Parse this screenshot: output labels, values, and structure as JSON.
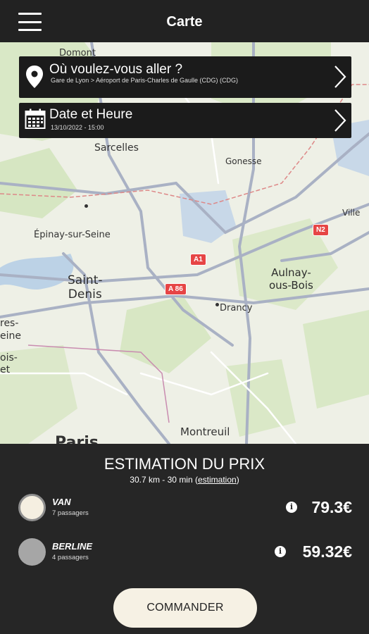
{
  "header": {
    "title": "Carte",
    "menu_icon": "hamburger-icon"
  },
  "map": {
    "places": {
      "domont": "Domont",
      "sarcelles": "Sarcelles",
      "gonesse": "Gonesse",
      "villepinte": "Ville",
      "epinay": "Épinay-sur-Seine",
      "saint_denis": "Saint-\nDenis",
      "aulnay": "Aulnay-\nous-Bois",
      "drancy": "Drancy",
      "cut_left_1": "res-\neine",
      "cut_left_2": "ois-\net",
      "montreuil": "Montreuil",
      "paris": "Paris"
    },
    "roads": {
      "a1": "A1",
      "a86": "A 86",
      "n2": "N2"
    }
  },
  "destination": {
    "label": "Où voulez-vous aller ?",
    "detail": "Gare de Lyon > Aéroport de Paris-Charles de Gaulle (CDG) (CDG)",
    "icon": "location-pin-icon"
  },
  "datetime": {
    "label": "Date et Heure",
    "detail": "13/10/2022 - 15:00",
    "icon": "calendar-icon"
  },
  "estimate": {
    "title": "ESTIMATION DU PRIX",
    "summary": "30.7 km - 30 min",
    "link": "estimation"
  },
  "vehicles": [
    {
      "name": "VAN",
      "passengers": "7 passagers",
      "price": "79.3€",
      "selected": true
    },
    {
      "name": "BERLINE",
      "passengers": "4 passagers",
      "price": "59.32€",
      "selected": false
    }
  ],
  "cta": {
    "label": "COMMANDER"
  },
  "colors": {
    "background": "#222222",
    "button": "#f6f1e4",
    "route_shield": "#e64545"
  }
}
